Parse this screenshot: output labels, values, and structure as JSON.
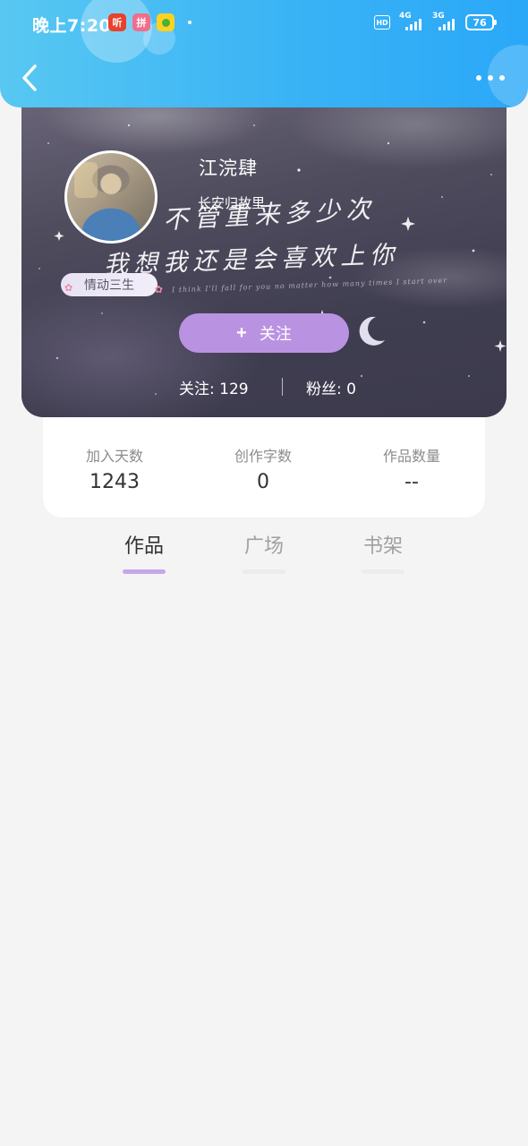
{
  "status_bar": {
    "time": "晚上7:20",
    "app_icons": [
      "tingshu-app-icon",
      "pinduoduo-app-icon",
      "lemon-app-icon"
    ],
    "app_icon_glyphs": [
      "听",
      "拼",
      ""
    ],
    "hd": "HD",
    "network_1": "4G",
    "network_2": "3G",
    "battery": "76"
  },
  "nav": {
    "back_icon": "chevron-left-icon",
    "more_icon": "more-dots-icon"
  },
  "profile": {
    "username": "江浣肆",
    "signature": "长安归故里",
    "title_badge": "情动三生",
    "follow_button": {
      "icon": "+",
      "label": "关注"
    },
    "follow_count_text": "关注: 129",
    "fans_count_text": "粉丝: 0",
    "cover_text_line1": "不管重来多少次",
    "cover_text_line2": "我想我还是会喜欢上你",
    "cover_text_small": "I think I'll fall for you no matter how many times I start over"
  },
  "stats": [
    {
      "label": "加入天数",
      "value": "1243"
    },
    {
      "label": "创作字数",
      "value": "0"
    },
    {
      "label": "作品数量",
      "value": "--"
    }
  ],
  "tabs": [
    {
      "label": "作品",
      "active": true
    },
    {
      "label": "广场",
      "active": false
    },
    {
      "label": "书架",
      "active": false
    }
  ],
  "colors": {
    "topbar_start": "#58c8f2",
    "topbar_end": "#2aa8f8",
    "follow_button": "#b993e2",
    "active_tab_indicator": "#c5a7ea",
    "page_background": "#f4f4f4"
  }
}
